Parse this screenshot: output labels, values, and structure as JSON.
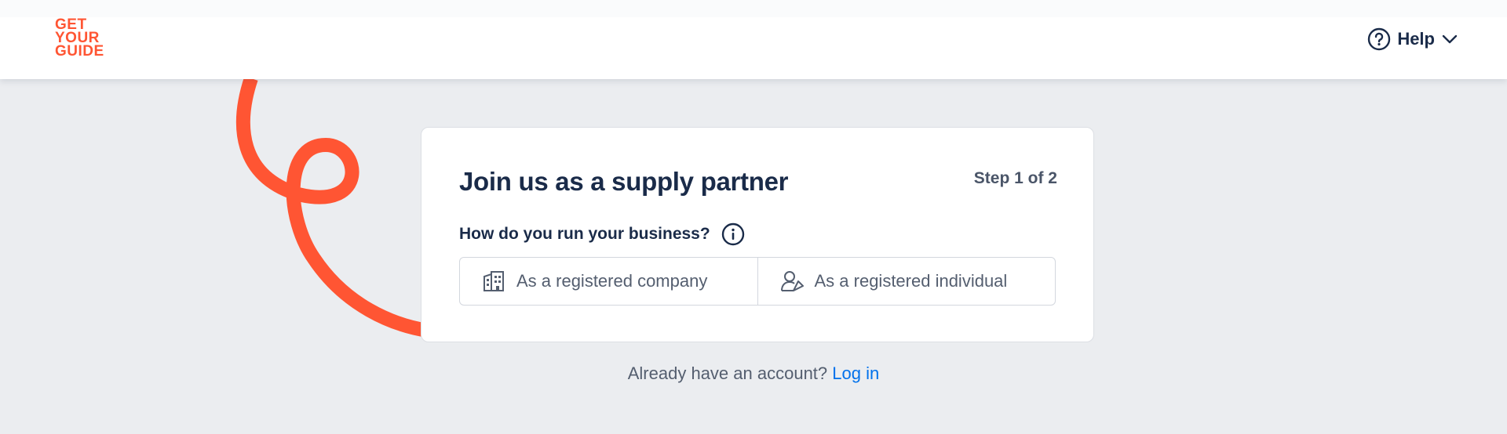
{
  "brand": {
    "logo_lines": [
      "GET",
      "YOUR",
      "GUIDE"
    ],
    "accent": "#ff5533"
  },
  "header": {
    "help_label": "Help",
    "help_icon": "question-circle-icon",
    "chevron_icon": "chevron-down-icon"
  },
  "card": {
    "title": "Join us as a supply partner",
    "step": "Step 1 of 2",
    "question": "How do you run your business?",
    "info_icon": "info-circle-icon",
    "options": [
      {
        "label": "As a registered company",
        "icon": "building-icon"
      },
      {
        "label": "As a registered individual",
        "icon": "person-icon"
      }
    ]
  },
  "footer": {
    "account_text": "Already have an account?",
    "login_label": "Log in",
    "link_color": "#0071eb"
  }
}
